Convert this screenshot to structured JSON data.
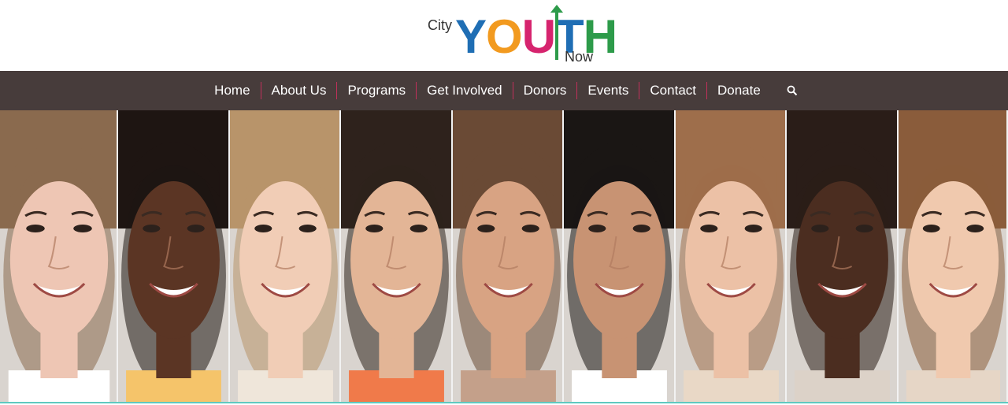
{
  "logo": {
    "prefix": "City",
    "word_letters": [
      {
        "char": "Y",
        "color": "#1f6eb4"
      },
      {
        "char": "O",
        "color": "#f29a1f"
      },
      {
        "char": "U",
        "color": "#d6246e"
      },
      {
        "char": "T",
        "color": "#1f6eb4"
      },
      {
        "char": "H",
        "color": "#2d9b4a"
      }
    ],
    "suffix": "Now",
    "arrow_color": "#2d9b4a"
  },
  "nav": {
    "items": [
      {
        "label": "Home"
      },
      {
        "label": "About Us"
      },
      {
        "label": "Programs"
      },
      {
        "label": "Get Involved"
      },
      {
        "label": "Donors"
      },
      {
        "label": "Events"
      },
      {
        "label": "Contact"
      },
      {
        "label": "Donate"
      }
    ],
    "search_icon": "search-icon",
    "background": "#473c3b",
    "divider_color": "#c1305a"
  },
  "hero": {
    "image": "smiling-young-faces-collage",
    "portraits": [
      {
        "skin": "#eec6b4",
        "hair": "#8a6a4e",
        "shirt": "#ffffff"
      },
      {
        "skin": "#5b3524",
        "hair": "#1e1512",
        "shirt": "#f5c46a"
      },
      {
        "skin": "#f1cdb6",
        "hair": "#b8946a",
        "shirt": "#efe6da"
      },
      {
        "skin": "#e3b596",
        "hair": "#2e221c",
        "shirt": "#f07a4a"
      },
      {
        "skin": "#d8a383",
        "hair": "#6a4a35",
        "shirt": "#c4a08a"
      },
      {
        "skin": "#c89373",
        "hair": "#1a1614",
        "shirt": "#ffffff"
      },
      {
        "skin": "#ecc1a6",
        "hair": "#9e6e4b",
        "shirt": "#e9d8c6"
      },
      {
        "skin": "#4b2d20",
        "hair": "#2a1d18",
        "shirt": "#dcd2c8"
      },
      {
        "skin": "#f0c9ae",
        "hair": "#8a5c3b",
        "shirt": "#e6d6c6"
      }
    ],
    "accent_line": "#5fc9c0"
  }
}
